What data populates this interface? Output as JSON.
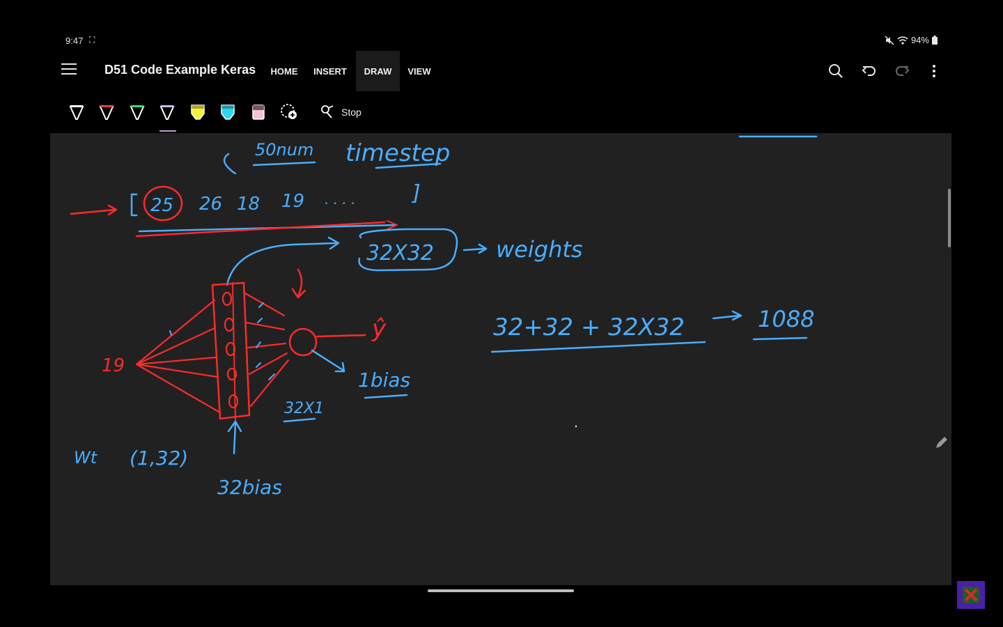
{
  "status": {
    "time": "9:47",
    "battery": "94%"
  },
  "app": {
    "notebook_title": "D51 Code Example Keras",
    "tabs": [
      {
        "label": "HOME",
        "active": false
      },
      {
        "label": "INSERT",
        "active": false
      },
      {
        "label": "DRAW",
        "active": true
      },
      {
        "label": "VIEW",
        "active": false
      }
    ]
  },
  "toolbar": {
    "pens": [
      {
        "name": "white-pen",
        "color": "#ffffff"
      },
      {
        "name": "red-pen",
        "color": "#ff3a4a"
      },
      {
        "name": "green-pen",
        "color": "#2ee07a"
      },
      {
        "name": "lavender-pen",
        "color": "#c9b8ff",
        "selected": true
      },
      {
        "name": "yellow-highlighter",
        "color": "#f5f03a"
      },
      {
        "name": "cyan-highlighter",
        "color": "#2ad8f0"
      },
      {
        "name": "pink-highlighter",
        "color": "#f7bfd8"
      }
    ],
    "stop_label": "Stop"
  },
  "ink": {
    "blue": "#4aaeff",
    "red": "#ff2a2a",
    "labels": {
      "num": "50num",
      "timestep": "timestep",
      "sequence": [
        "25",
        "26",
        "18",
        "19",
        ". . . .",
        "]"
      ],
      "matrix": "32X32",
      "weights": "weights",
      "equation": "32+32 + 32X32",
      "total": "1088",
      "input_count": "19",
      "yhat": "ŷ",
      "bias_one": "1bias",
      "w_out": "32X1",
      "wt": "Wt",
      "wt_shape": "(1,32)",
      "bias_32": "32bias"
    }
  }
}
